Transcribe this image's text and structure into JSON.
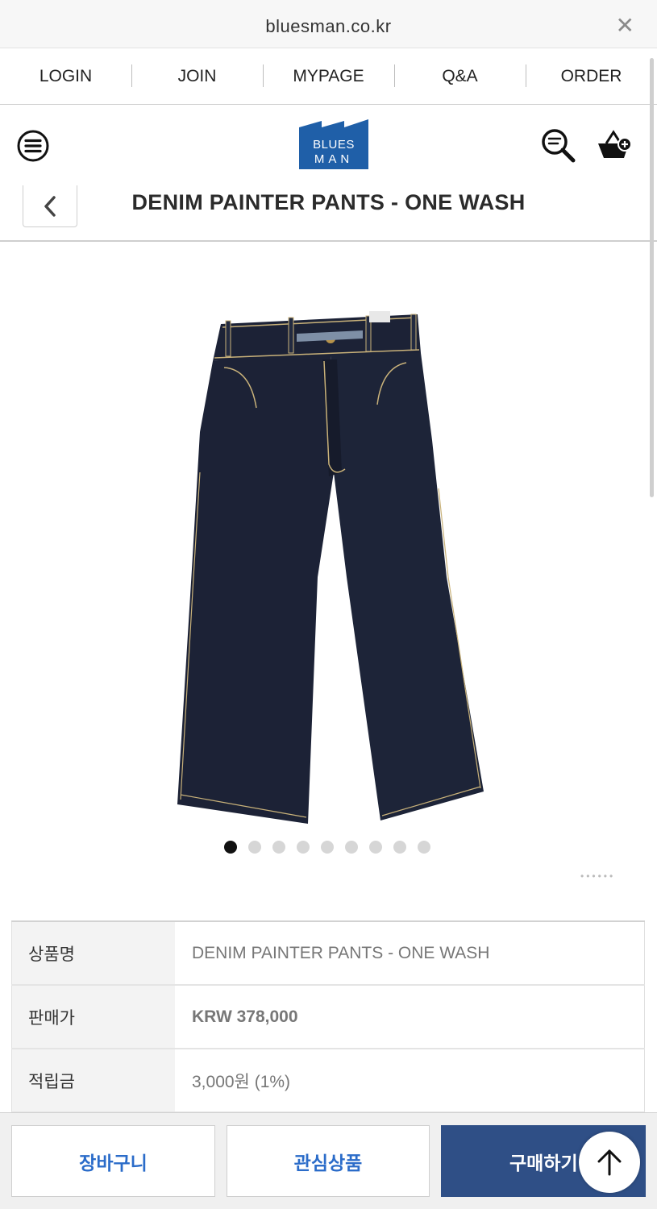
{
  "browser": {
    "url": "bluesman.co.kr",
    "close_glyph": "✕"
  },
  "topnav": {
    "items": [
      "LOGIN",
      "JOIN",
      "MYPAGE",
      "Q&A",
      "ORDER"
    ]
  },
  "header": {
    "logo_text_line1": "BLUES",
    "logo_text_line2": "MAN",
    "icons": [
      "menu-icon",
      "search-icon",
      "cart-add-icon"
    ]
  },
  "titlebar": {
    "title": "DENIM PAINTER PANTS - ONE WASH",
    "back_icon": "chevron-left-icon"
  },
  "gallery": {
    "slide_count": 9,
    "active_index": 0
  },
  "product_info": {
    "rows": [
      {
        "label": "상품명",
        "value": "DENIM PAINTER PANTS - ONE WASH"
      },
      {
        "label": "판매가",
        "value": "KRW 378,000"
      },
      {
        "label": "적립금",
        "value": "3,000원 (1%)"
      }
    ]
  },
  "actions": {
    "cart_label": "장바구니",
    "wish_label": "관심상품",
    "buy_label": "구매하기"
  },
  "colors": {
    "brand_blue": "#1f5fa8",
    "buy_button": "#2f4f86",
    "action_text": "#2b6cc9",
    "denim": "#1c2236"
  }
}
